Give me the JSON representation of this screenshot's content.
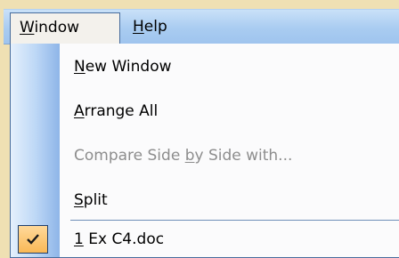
{
  "menubar": {
    "items": [
      {
        "mnemonic": "W",
        "rest": "indow"
      },
      {
        "mnemonic": "H",
        "rest": "elp"
      }
    ]
  },
  "menu": {
    "items": [
      {
        "before": "",
        "mnemonic": "N",
        "after": "ew Window",
        "enabled": true
      },
      {
        "before": "",
        "mnemonic": "A",
        "after": "rrange All",
        "enabled": true
      },
      {
        "before": "Compare Side ",
        "mnemonic": "b",
        "after": "y Side with...",
        "enabled": false
      },
      {
        "before": "",
        "mnemonic": "S",
        "after": "plit",
        "enabled": true
      },
      {
        "before": "",
        "mnemonic": "1",
        "after": " Ex C4.doc",
        "enabled": true,
        "checked": true,
        "check_icon": "checkmark-icon"
      }
    ]
  },
  "colors": {
    "background": "#efe0b3",
    "menubar": "#a9ccf1",
    "menu_background": "#fbfbfc",
    "disabled_text": "#8d8d8d",
    "check_highlight": "#f9b856"
  }
}
